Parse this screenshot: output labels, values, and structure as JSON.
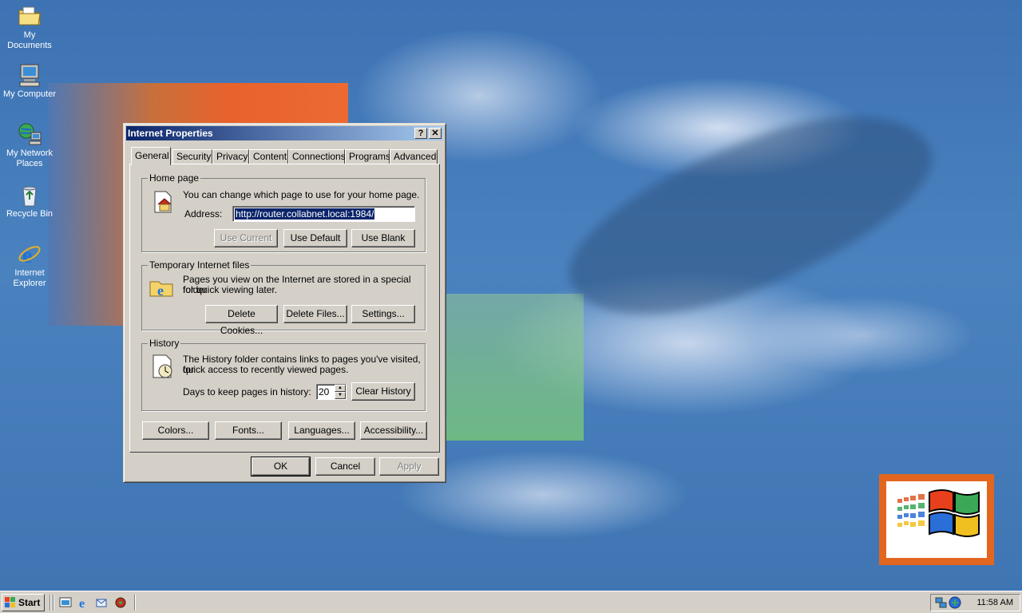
{
  "desktop": {
    "icons": [
      {
        "label": "My Documents",
        "icon": "folder-documents-icon"
      },
      {
        "label": "My Computer",
        "icon": "computer-icon"
      },
      {
        "label": "My Network Places",
        "icon": "network-places-icon"
      },
      {
        "label": "Recycle Bin",
        "icon": "recycle-bin-icon"
      },
      {
        "label": "Internet Explorer",
        "icon": "internet-explorer-icon"
      }
    ]
  },
  "dialog": {
    "title": "Internet Properties",
    "help_glyph": "?",
    "close_glyph": "✕",
    "tabs": [
      "General",
      "Security",
      "Privacy",
      "Content",
      "Connections",
      "Programs",
      "Advanced"
    ],
    "active_tab": "General",
    "home_page": {
      "group_label": "Home page",
      "description": "You can change which page to use for your home page.",
      "address_label": "Address:",
      "address_value": "http://router.collabnet.local:1984/",
      "use_current": "Use Current",
      "use_default": "Use Default",
      "use_blank": "Use Blank"
    },
    "temp_files": {
      "group_label": "Temporary Internet files",
      "description_line1": "Pages you view on the Internet are stored in a special folder",
      "description_line2": "for quick viewing later.",
      "delete_cookies": "Delete Cookies...",
      "delete_files": "Delete Files...",
      "settings": "Settings..."
    },
    "history": {
      "group_label": "History",
      "description_line1": "The History folder contains links to pages you've visited, for",
      "description_line2": "quick access to recently viewed pages.",
      "days_label": "Days to keep pages in history:",
      "days_value": "20",
      "clear_history": "Clear History"
    },
    "bottom_buttons": {
      "colors": "Colors...",
      "fonts": "Fonts...",
      "languages": "Languages...",
      "accessibility": "Accessibility..."
    },
    "ok": "OK",
    "cancel": "Cancel",
    "apply": "Apply"
  },
  "taskbar": {
    "start_label": "Start",
    "quick_launch": [
      "show-desktop-icon",
      "internet-explorer-icon",
      "outlook-express-icon",
      "media-player-icon"
    ],
    "tray_icons": [
      "network-tray-icon",
      "update-tray-icon"
    ],
    "clock": "11:58 AM"
  },
  "colors": {
    "title_active": "#0a246a",
    "face": "#d4d0c8",
    "desktop": "#3a6ea5"
  }
}
